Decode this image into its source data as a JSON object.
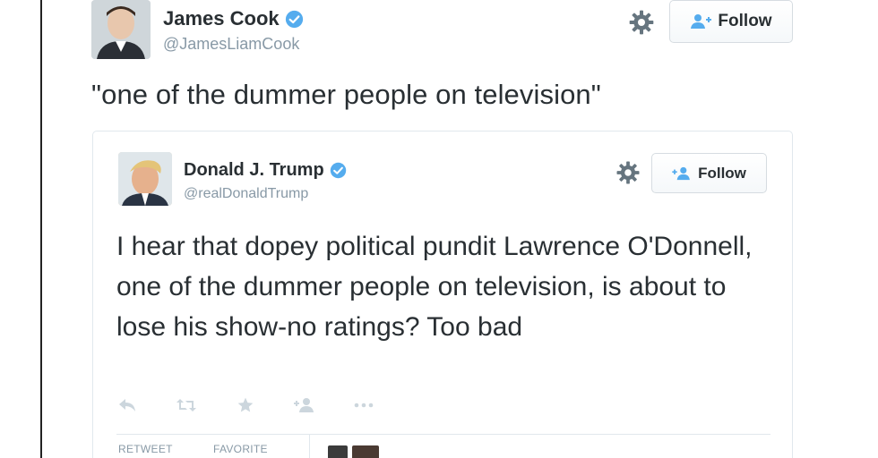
{
  "outer_tweet": {
    "name": "James Cook",
    "handle": "@JamesLiamCook",
    "follow_label": "Follow",
    "text": "\"one of the dummer people on television\""
  },
  "quoted_tweet": {
    "name": "Donald J. Trump",
    "handle": "@realDonaldTrump",
    "follow_label": "Follow",
    "text": "I hear that dopey political pundit Lawrence O'Donnell, one of the dummer people on television, is about to lose his show-no ratings? Too bad",
    "stats": {
      "retweet_label": "RETWEET",
      "favorite_label": "FAVORITE"
    }
  },
  "icons": [
    "verified-badge-icon",
    "gear-icon",
    "add-user-icon",
    "reply-icon",
    "retweet-icon",
    "favorite-star-icon",
    "follow-person-icon",
    "more-dots-icon"
  ],
  "colors": {
    "accent": "#55acee",
    "text": "#292f33",
    "muted": "#8899a6",
    "border": "#e1e8ed"
  }
}
